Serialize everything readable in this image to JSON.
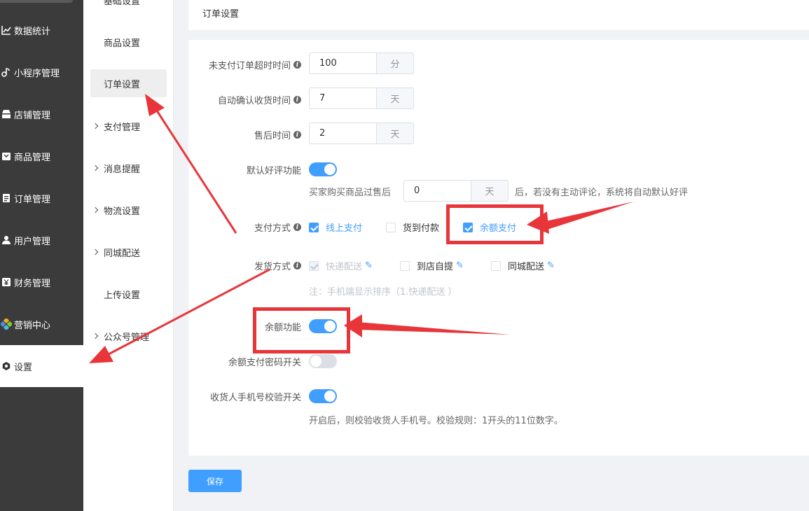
{
  "sidebar": {
    "items": [
      {
        "label": "数据统计",
        "icon": "chart-line-icon"
      },
      {
        "label": "小程序管理",
        "icon": "music-note-icon"
      },
      {
        "label": "店铺管理",
        "icon": "shop-icon"
      },
      {
        "label": "商品管理",
        "icon": "box-icon"
      },
      {
        "label": "订单管理",
        "icon": "clipboard-icon"
      },
      {
        "label": "用户管理",
        "icon": "user-icon"
      },
      {
        "label": "财务管理",
        "icon": "yen-icon"
      },
      {
        "label": "营销中心",
        "icon": "colorful-grid-icon"
      },
      {
        "label": "设置",
        "icon": "gear-icon"
      }
    ]
  },
  "submenu": {
    "items": [
      {
        "label": "基础设置"
      },
      {
        "label": "商品设置"
      },
      {
        "label": "订单设置"
      },
      {
        "label": "支付管理"
      },
      {
        "label": "消息提醒"
      },
      {
        "label": "物流设置"
      },
      {
        "label": "同城配送"
      },
      {
        "label": "上传设置"
      },
      {
        "label": "公众号管理"
      }
    ]
  },
  "header": {
    "title": "订单设置"
  },
  "form": {
    "unpaid_timeout": {
      "label": "未支付订单超时时间",
      "value": "100",
      "unit": "分"
    },
    "auto_confirm": {
      "label": "自动确认收货时间",
      "value": "7",
      "unit": "天"
    },
    "after_sale": {
      "label": "售后时间",
      "value": "2",
      "unit": "天"
    },
    "default_review": {
      "label": "默认好评功能",
      "enabled": true,
      "prefix": "买家购买商品过售后",
      "value": "0",
      "unit": "天",
      "suffix": "后，若没有主动评论，系统将自动默认好评"
    },
    "payment": {
      "label": "支付方式",
      "options": [
        {
          "label": "线上支付",
          "checked": true
        },
        {
          "label": "货到付款",
          "checked": false
        },
        {
          "label": "余额支付",
          "checked": true
        }
      ]
    },
    "delivery": {
      "label": "发货方式",
      "options": [
        {
          "label": "快递配送",
          "checked": true,
          "disabled": true
        },
        {
          "label": "到店自提",
          "checked": false
        },
        {
          "label": "同城配送",
          "checked": false
        }
      ],
      "note": "注：手机端显示排序（1.快递配送 ）"
    },
    "balance": {
      "label": "余额功能",
      "enabled": true
    },
    "balance_pwd": {
      "label": "余额支付密码开关",
      "enabled": false
    },
    "phone_check": {
      "label": "收货人手机号校验开关",
      "enabled": true,
      "hint": "开启后，则校验收货人手机号。校验规则：1开头的11位数字。"
    }
  },
  "actions": {
    "save_label": "保存"
  },
  "colors": {
    "primary": "#409eff",
    "annotation": "#e8353a",
    "sidebar_bg": "#3b3b3b"
  }
}
